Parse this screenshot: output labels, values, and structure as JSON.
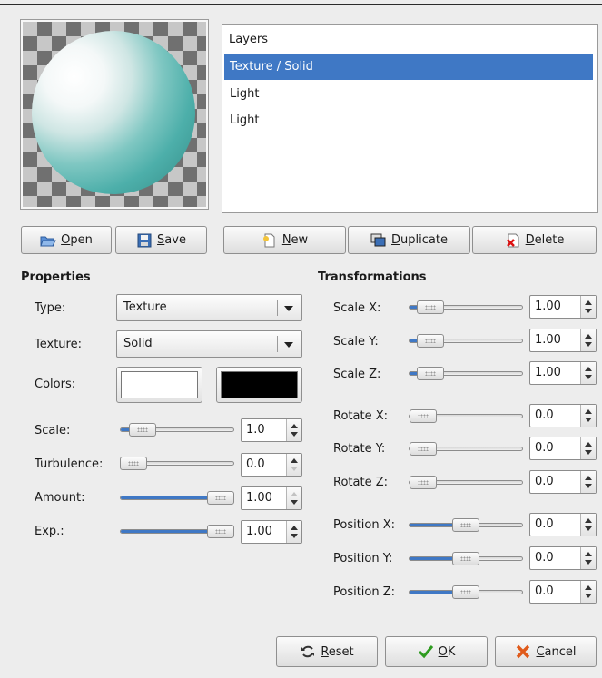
{
  "layers": {
    "title": "Layers",
    "items": [
      "Texture / Solid",
      "Light",
      "Light"
    ]
  },
  "buttons": {
    "open": "Open",
    "save": "Save",
    "new": "New",
    "duplicate": "Duplicate",
    "delete": "Delete",
    "reset": "Reset",
    "ok": "OK",
    "cancel": "Cancel"
  },
  "properties": {
    "heading": "Properties",
    "type_label": "Type:",
    "type_value": "Texture",
    "texture_label": "Texture:",
    "texture_value": "Solid",
    "colors_label": "Colors:",
    "color1": "#ffffff",
    "color2": "#000000",
    "scale_label": "Scale:",
    "scale_value": "1.0",
    "turbulence_label": "Turbulence:",
    "turbulence_value": "0.0",
    "amount_label": "Amount:",
    "amount_value": "1.00",
    "exp_label": "Exp.:",
    "exp_value": "1.00"
  },
  "transformations": {
    "heading": "Transformations",
    "scale_x_label": "Scale X:",
    "scale_x_value": "1.00",
    "scale_y_label": "Scale Y:",
    "scale_y_value": "1.00",
    "scale_z_label": "Scale Z:",
    "scale_z_value": "1.00",
    "rotate_x_label": "Rotate X:",
    "rotate_x_value": "0.0",
    "rotate_y_label": "Rotate Y:",
    "rotate_y_value": "0.0",
    "rotate_z_label": "Rotate Z:",
    "rotate_z_value": "0.0",
    "position_x_label": "Position X:",
    "position_x_value": "0.0",
    "position_y_label": "Position Y:",
    "position_y_value": "0.0",
    "position_z_label": "Position Z:",
    "position_z_value": "0.0"
  },
  "colors": {
    "selection": "#3f78c5",
    "sphere": "#4dafaa"
  }
}
